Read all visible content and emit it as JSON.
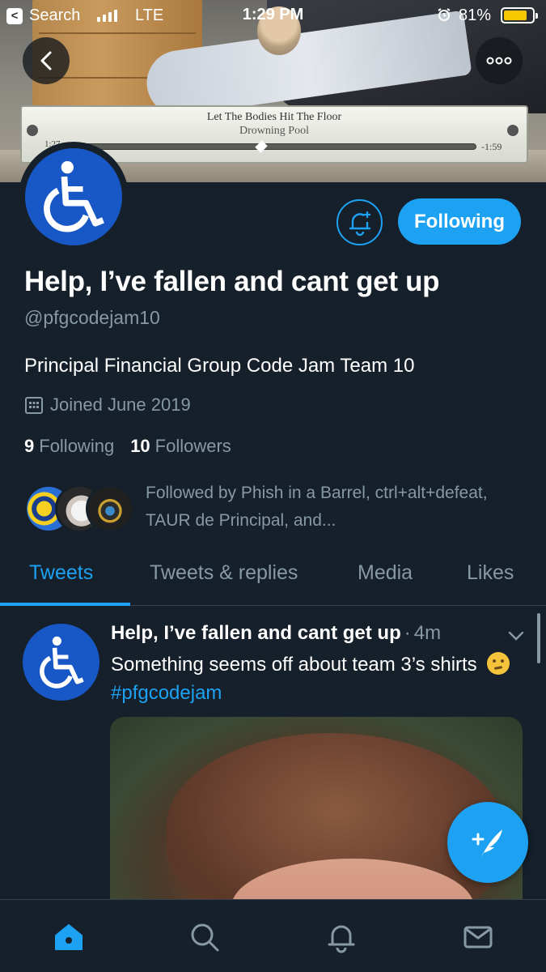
{
  "status_bar": {
    "back_app": "Search",
    "network": "LTE",
    "time": "1:29 PM",
    "battery_pct": "81%",
    "battery_level": 0.81
  },
  "banner": {
    "song": "Let The Bodies Hit The Floor",
    "artist": "Drowning Pool",
    "elapsed": "1:27",
    "remaining": "-1:59"
  },
  "profile": {
    "display_name": "Help, I’ve fallen and cant get up",
    "handle": "@pfgcodejam10",
    "bio": "Principal Financial Group Code Jam Team 10",
    "joined": "Joined June 2019",
    "following_count": "9",
    "following_label": "Following",
    "followers_count": "10",
    "followers_label": "Followers",
    "follow_button": "Following",
    "followed_by": "Followed by Phish in a Barrel, ctrl+alt+defeat, TAUR de Principal, and..."
  },
  "tabs": [
    {
      "label": "Tweets",
      "active": true
    },
    {
      "label": "Tweets & replies",
      "active": false
    },
    {
      "label": "Media",
      "active": false
    },
    {
      "label": "Likes",
      "active": false
    }
  ],
  "tweet": {
    "name": "Help, I’ve fallen and cant get up",
    "separator": "·",
    "time_ago": "4m",
    "text": "Something seems off about team 3’s shirts",
    "hashtag": "#pfgcodejam"
  },
  "colors": {
    "background": "#15202b",
    "accent": "#1da1f2",
    "secondary_text": "#8899a6",
    "avatar_blue": "#1857c6"
  },
  "icons": {
    "back": "chevron-left-icon",
    "more": "more-options-icon",
    "bell": "notification-bell-plus-icon",
    "calendar": "calendar-icon",
    "compose": "compose-tweet-icon",
    "home": "home-icon",
    "search": "search-icon",
    "notifications": "notifications-icon",
    "messages": "mail-icon"
  }
}
